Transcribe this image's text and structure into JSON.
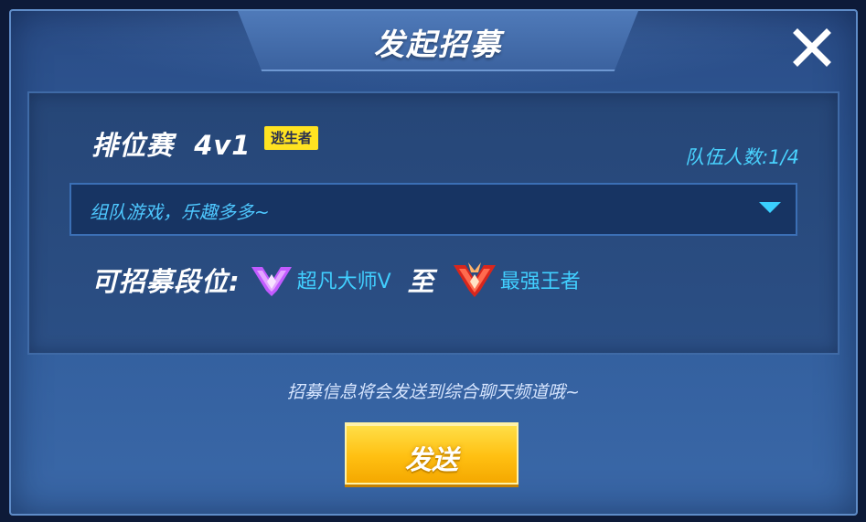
{
  "dialog": {
    "title": "发起招募",
    "close_icon": "close-icon"
  },
  "recruit": {
    "mode": "排位赛",
    "format": "4v1",
    "role_badge": "逃生者",
    "team_count_label": "队伍人数:",
    "team_count_value": "1/4",
    "message": "组队游戏，乐趣多多~",
    "dropdown_icon": "chevron-down-icon",
    "rank_label": "可招募段位:",
    "rank_from": "超凡大师V",
    "rank_from_icon": "rank-master-icon",
    "to_word": "至",
    "rank_to": "最强王者",
    "rank_to_icon": "rank-king-icon"
  },
  "note": "招募信息将会发送到综合聊天频道哦~",
  "send_label": "发送",
  "colors": {
    "accent_cyan": "#41cfff",
    "badge_yellow": "#ffe321",
    "button_yellow": "#ffc012",
    "rank_from_color": "#c25bff",
    "rank_to_color": "#ff4a3a"
  }
}
